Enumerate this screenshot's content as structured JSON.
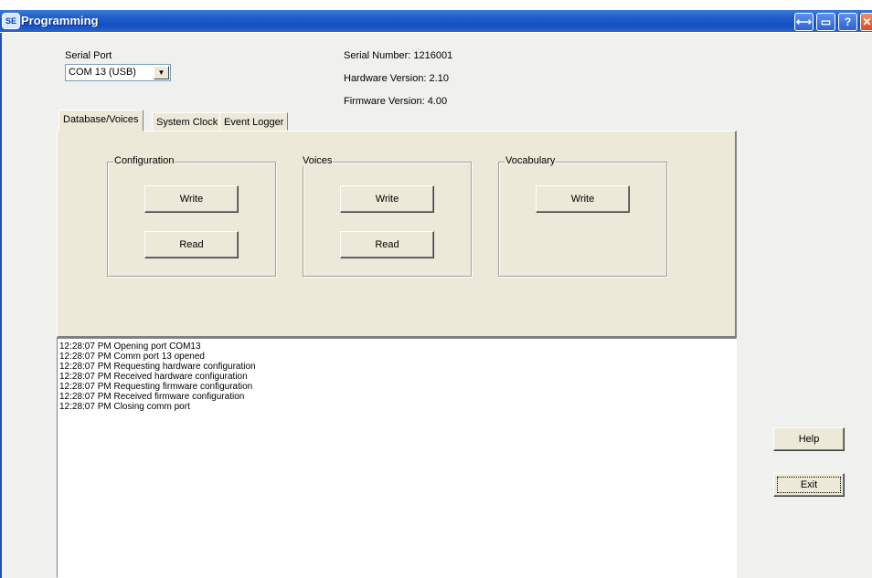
{
  "window": {
    "title": "Programming",
    "icon_text": "SE"
  },
  "titlebar_buttons": [
    "restore",
    "minimize-to-tray",
    "help",
    "close"
  ],
  "serial_port": {
    "label": "Serial Port",
    "selected": "COM 13 (USB)"
  },
  "device_info": {
    "serial_number": "Serial Number: 1216001",
    "hardware_version": "Hardware Version: 2.10",
    "firmware_version": "Firmware Version:  4.00"
  },
  "tabs": [
    {
      "label": "Database/Voices",
      "active": true
    },
    {
      "label": "System Clock",
      "active": false
    },
    {
      "label": "Event Logger",
      "active": false
    }
  ],
  "groups": {
    "configuration": {
      "title": "Configuration",
      "write": "Write",
      "read": "Read"
    },
    "voices": {
      "title": "Voices",
      "write": "Write",
      "read": "Read"
    },
    "vocabulary": {
      "title": "Vocabulary",
      "write": "Write"
    }
  },
  "log": [
    "12:28:07 PM  Opening port COM13",
    "12:28:07 PM  Comm port 13 opened",
    "12:28:07 PM  Requesting hardware configuration",
    "12:28:07 PM  Received hardware configuration",
    "12:28:07 PM  Requesting firmware configuration",
    "12:28:07 PM  Received firmware configuration",
    "12:28:07 PM  Closing comm port"
  ],
  "side_buttons": {
    "help": "Help",
    "exit": "Exit"
  }
}
